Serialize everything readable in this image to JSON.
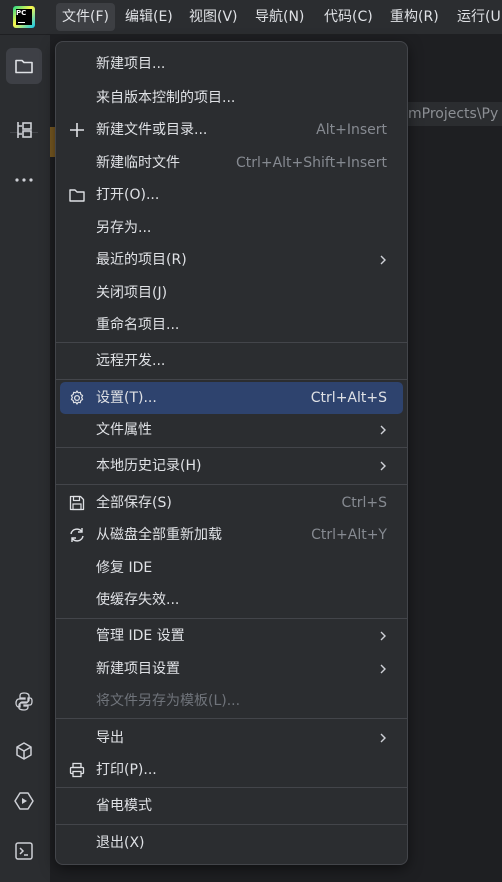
{
  "menubar": {
    "items": [
      "文件(F)",
      "编辑(E)",
      "视图(V)",
      "导航(N)",
      "代码(C)",
      "重构(R)",
      "运行(U"
    ]
  },
  "editor": {
    "path_hint": "mProjects\\Py"
  },
  "menu": {
    "items": [
      {
        "label": "新建项目...",
        "shortcut": ""
      },
      {
        "label": "来自版本控制的项目...",
        "shortcut": ""
      },
      {
        "label": "新建文件或目录...",
        "shortcut": "Alt+Insert",
        "icon": "plus-icon"
      },
      {
        "label": "新建临时文件",
        "shortcut": "Ctrl+Alt+Shift+Insert"
      },
      {
        "label": "打开(O)...",
        "shortcut": "",
        "icon": "folder-icon"
      },
      {
        "label": "另存为...",
        "shortcut": ""
      },
      {
        "label": "最近的项目(R)",
        "shortcut": "",
        "submenu": true
      },
      {
        "label": "关闭项目(J)",
        "shortcut": ""
      },
      {
        "label": "重命名项目...",
        "shortcut": ""
      },
      {
        "label": "远程开发...",
        "shortcut": ""
      },
      {
        "label": "设置(T)...",
        "shortcut": "Ctrl+Alt+S",
        "icon": "gear-icon",
        "selected": true
      },
      {
        "label": "文件属性",
        "shortcut": "",
        "submenu": true
      },
      {
        "label": "本地历史记录(H)",
        "shortcut": "",
        "submenu": true
      },
      {
        "label": "全部保存(S)",
        "shortcut": "Ctrl+S",
        "icon": "save-icon"
      },
      {
        "label": "从磁盘全部重新加载",
        "shortcut": "Ctrl+Alt+Y",
        "icon": "reload-icon"
      },
      {
        "label": "修复 IDE",
        "shortcut": ""
      },
      {
        "label": "使缓存失效...",
        "shortcut": ""
      },
      {
        "label": "管理 IDE 设置",
        "shortcut": "",
        "submenu": true
      },
      {
        "label": "新建项目设置",
        "shortcut": "",
        "submenu": true
      },
      {
        "label": "将文件另存为模板(L)...",
        "shortcut": "",
        "disabled": true
      },
      {
        "label": "导出",
        "shortcut": "",
        "submenu": true
      },
      {
        "label": "打印(P)...",
        "shortcut": "",
        "icon": "print-icon"
      },
      {
        "label": "省电模式",
        "shortcut": ""
      },
      {
        "label": "退出(X)",
        "shortcut": ""
      }
    ]
  },
  "colors": {
    "menu_bg": "#2b2d30",
    "selected_bg": "#2e436e",
    "separator": "#43454a",
    "text": "#dfe1e5",
    "shortcut_text": "#868a91"
  }
}
